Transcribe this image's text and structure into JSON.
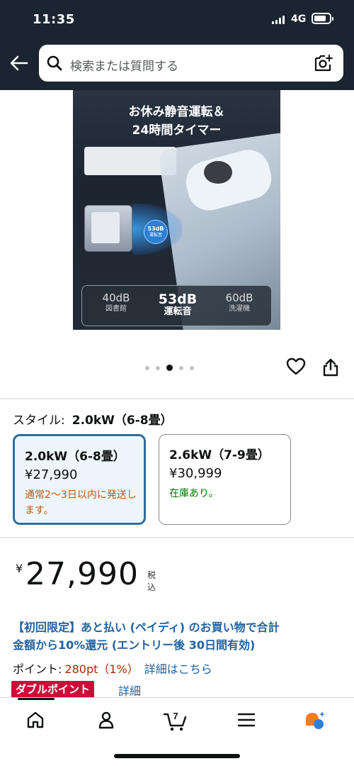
{
  "status_bar": {
    "time": "11:35",
    "network": "4G"
  },
  "search": {
    "placeholder": "検索または質問する"
  },
  "gallery": {
    "title_line1": "お休み静音運転＆",
    "title_line2": "24時間タイマー",
    "badge_db": "53dB",
    "badge_label": "運転音",
    "levels": [
      {
        "db": "40dB",
        "label": "図書館"
      },
      {
        "db": "53dB",
        "label": "運転音"
      },
      {
        "db": "60dB",
        "label": "洗濯機"
      }
    ],
    "dot_count": 5,
    "active_dot": 3
  },
  "style": {
    "label": "スタイル:",
    "selected": "2.0kW（6-8畳）",
    "options": [
      {
        "name": "2.0kW（6-8畳）",
        "price": "¥27,990",
        "availability": "通常2〜3日以内に発送します。"
      },
      {
        "name": "2.6kW（7-9畳）",
        "price": "¥30,999",
        "availability": "在庫あり。"
      }
    ]
  },
  "price": {
    "currency": "¥",
    "amount": "27,990",
    "tax": "税込"
  },
  "promo": {
    "line1": "【初回限定】あと払い (ペイディ) のお買い物で合計",
    "line2": "金額から10%還元 (エントリー後 30日間有効)"
  },
  "points": {
    "label": "ポイント:",
    "value": "280pt（1%）",
    "link": "詳細はこちら",
    "double_badge": "ダブルポイント",
    "double_link": "詳細"
  },
  "bottom_nav": {
    "items": [
      "home-icon",
      "account-icon",
      "cart-icon",
      "menu-icon",
      "rufus-icon"
    ],
    "cart_count": "7"
  },
  "colors": {
    "header_bg": "#1b2531",
    "link": "#2162a1",
    "price_red": "#b12704",
    "selected_border": "#2f6d9f",
    "in_stock": "#007600",
    "ship_orange": "#c45500",
    "double_badge": "#cc0c39"
  }
}
